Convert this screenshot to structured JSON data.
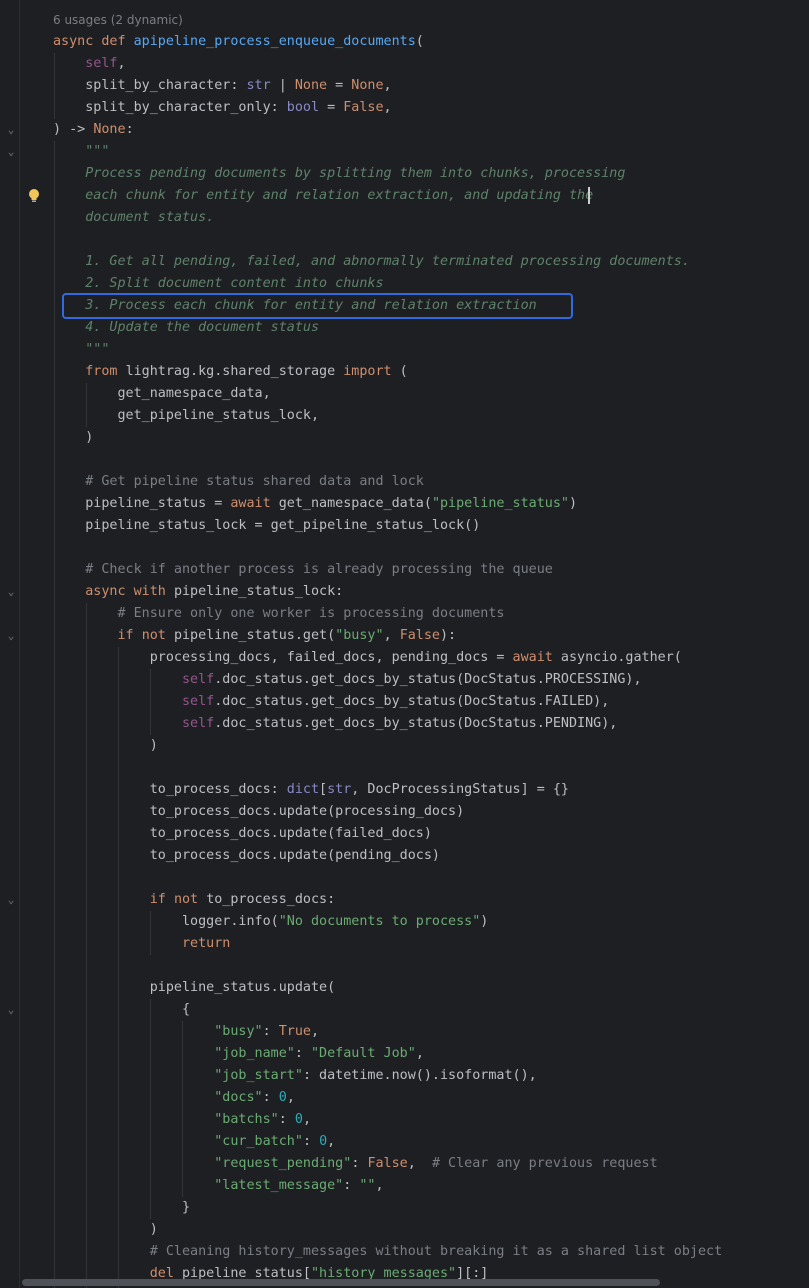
{
  "editor": {
    "usage_hint": "6 usages (2 dynamic)",
    "lines": [
      [
        [
          "kw",
          "async "
        ],
        [
          "kw",
          "def "
        ],
        [
          "fn",
          "apipeline_process_enqueue_documents"
        ],
        [
          "",
          "("
        ]
      ],
      [
        [
          "",
          "    "
        ],
        [
          "self",
          "self"
        ],
        [
          "",
          ","
        ]
      ],
      [
        [
          "",
          "    split_by_character: "
        ],
        [
          "builtin",
          "str"
        ],
        [
          "",
          " | "
        ],
        [
          "kw",
          "None"
        ],
        [
          "",
          " = "
        ],
        [
          "kw",
          "None"
        ],
        [
          "",
          ","
        ]
      ],
      [
        [
          "",
          "    split_by_character_only: "
        ],
        [
          "builtin",
          "bool"
        ],
        [
          "",
          " = "
        ],
        [
          "kw",
          "False"
        ],
        [
          "",
          ","
        ]
      ],
      [
        [
          "",
          ") -> "
        ],
        [
          "kw",
          "None"
        ],
        [
          "",
          ":"
        ]
      ],
      [
        [
          "doc",
          "    \"\"\""
        ]
      ],
      [
        [
          "doc",
          "    Process pending documents by splitting them into chunks, processing"
        ]
      ],
      [
        [
          "doc",
          "    each chunk for entity and relation extraction, and updating the"
        ]
      ],
      [
        [
          "doc",
          "    document status."
        ]
      ],
      [
        [
          "",
          ""
        ]
      ],
      [
        [
          "doc",
          "    1. Get all pending, failed, and abnormally terminated processing documents."
        ]
      ],
      [
        [
          "doc",
          "    2. Split document content into chunks"
        ]
      ],
      [
        [
          "doc",
          "    3. Process each chunk for entity and relation extraction"
        ]
      ],
      [
        [
          "doc",
          "    4. Update the document status"
        ]
      ],
      [
        [
          "doc",
          "    \"\"\""
        ]
      ],
      [
        [
          "kw",
          "    from "
        ],
        [
          "",
          "lightrag.kg.shared_storage "
        ],
        [
          "kw",
          "import "
        ],
        [
          "",
          "("
        ]
      ],
      [
        [
          "",
          "        get_namespace_data,"
        ]
      ],
      [
        [
          "",
          "        get_pipeline_status_lock,"
        ]
      ],
      [
        [
          "",
          "    )"
        ]
      ],
      [
        [
          "",
          ""
        ]
      ],
      [
        [
          "cmt",
          "    # Get pipeline status shared data and lock"
        ]
      ],
      [
        [
          "",
          "    pipeline_status = "
        ],
        [
          "kw",
          "await "
        ],
        [
          "",
          "get_namespace_data("
        ],
        [
          "str",
          "\"pipeline_status\""
        ],
        [
          "",
          ")"
        ]
      ],
      [
        [
          "",
          "    pipeline_status_lock = get_pipeline_status_lock()"
        ]
      ],
      [
        [
          "",
          ""
        ]
      ],
      [
        [
          "cmt",
          "    # Check if another process is already processing the queue"
        ]
      ],
      [
        [
          "kw",
          "    async "
        ],
        [
          "kw",
          "with "
        ],
        [
          "",
          "pipeline_status_lock:"
        ]
      ],
      [
        [
          "cmt",
          "        # Ensure only one worker is processing documents"
        ]
      ],
      [
        [
          "kw",
          "        if "
        ],
        [
          "kw",
          "not "
        ],
        [
          "",
          "pipeline_status.get("
        ],
        [
          "str",
          "\"busy\""
        ],
        [
          "",
          ", "
        ],
        [
          "kw",
          "False"
        ],
        [
          "",
          "):"
        ]
      ],
      [
        [
          "",
          "            processing_docs, failed_docs, pending_docs = "
        ],
        [
          "kw",
          "await "
        ],
        [
          "",
          "asyncio.gather("
        ]
      ],
      [
        [
          "",
          "                "
        ],
        [
          "self",
          "self"
        ],
        [
          "",
          ".doc_status.get_docs_by_status(DocStatus.PROCESSING),"
        ]
      ],
      [
        [
          "",
          "                "
        ],
        [
          "self",
          "self"
        ],
        [
          "",
          ".doc_status.get_docs_by_status(DocStatus.FAILED),"
        ]
      ],
      [
        [
          "",
          "                "
        ],
        [
          "self",
          "self"
        ],
        [
          "",
          ".doc_status.get_docs_by_status(DocStatus.PENDING),"
        ]
      ],
      [
        [
          "",
          "            )"
        ]
      ],
      [
        [
          "",
          ""
        ]
      ],
      [
        [
          "",
          "            to_process_docs: "
        ],
        [
          "builtin",
          "dict"
        ],
        [
          "",
          "["
        ],
        [
          "builtin",
          "str"
        ],
        [
          "",
          ", DocProcessingStatus] = {}"
        ]
      ],
      [
        [
          "",
          "            to_process_docs.update(processing_docs)"
        ]
      ],
      [
        [
          "",
          "            to_process_docs.update(failed_docs)"
        ]
      ],
      [
        [
          "",
          "            to_process_docs.update(pending_docs)"
        ]
      ],
      [
        [
          "",
          ""
        ]
      ],
      [
        [
          "kw",
          "            if "
        ],
        [
          "kw",
          "not "
        ],
        [
          "",
          "to_process_docs:"
        ]
      ],
      [
        [
          "",
          "                logger.info("
        ],
        [
          "str",
          "\"No documents to process\""
        ],
        [
          "",
          ")"
        ]
      ],
      [
        [
          "kw",
          "                return"
        ]
      ],
      [
        [
          "",
          ""
        ]
      ],
      [
        [
          "",
          "            pipeline_status.update("
        ]
      ],
      [
        [
          "",
          "                {"
        ]
      ],
      [
        [
          "",
          "                    "
        ],
        [
          "str",
          "\"busy\""
        ],
        [
          "",
          ": "
        ],
        [
          "kw",
          "True"
        ],
        [
          "",
          ","
        ]
      ],
      [
        [
          "",
          "                    "
        ],
        [
          "str",
          "\"job_name\""
        ],
        [
          "",
          ": "
        ],
        [
          "str",
          "\"Default Job\""
        ],
        [
          "",
          ","
        ]
      ],
      [
        [
          "",
          "                    "
        ],
        [
          "str",
          "\"job_start\""
        ],
        [
          "",
          ": datetime.now().isoformat(),"
        ]
      ],
      [
        [
          "",
          "                    "
        ],
        [
          "str",
          "\"docs\""
        ],
        [
          "",
          ": "
        ],
        [
          "num",
          "0"
        ],
        [
          "",
          ","
        ]
      ],
      [
        [
          "",
          "                    "
        ],
        [
          "str",
          "\"batchs\""
        ],
        [
          "",
          ": "
        ],
        [
          "num",
          "0"
        ],
        [
          "",
          ","
        ]
      ],
      [
        [
          "",
          "                    "
        ],
        [
          "str",
          "\"cur_batch\""
        ],
        [
          "",
          ": "
        ],
        [
          "num",
          "0"
        ],
        [
          "",
          ","
        ]
      ],
      [
        [
          "",
          "                    "
        ],
        [
          "str",
          "\"request_pending\""
        ],
        [
          "",
          ": "
        ],
        [
          "kw",
          "False"
        ],
        [
          "",
          ",  "
        ],
        [
          "cmt",
          "# Clear any previous request"
        ]
      ],
      [
        [
          "",
          "                    "
        ],
        [
          "str",
          "\"latest_message\""
        ],
        [
          "",
          ": "
        ],
        [
          "str",
          "\"\""
        ],
        [
          "",
          ","
        ]
      ],
      [
        [
          "",
          "                }"
        ]
      ],
      [
        [
          "",
          "            )"
        ]
      ],
      [
        [
          "cmt",
          "            # Cleaning history_messages without breaking it as a shared list object"
        ]
      ],
      [
        [
          "kw",
          "            del "
        ],
        [
          "",
          "pipeline_status["
        ],
        [
          "str",
          "\"history_messages\""
        ],
        [
          "",
          "][:]"
        ]
      ]
    ]
  }
}
